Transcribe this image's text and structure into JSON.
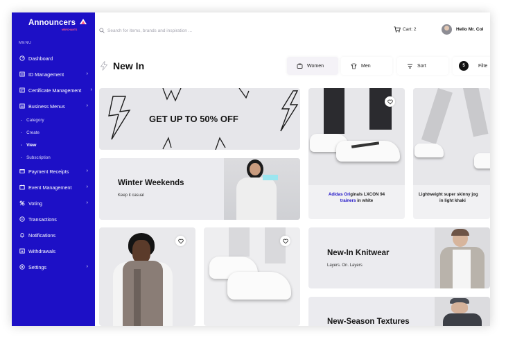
{
  "app": {
    "brand": "Announcers",
    "brand_sub": "MERCHANTS",
    "menu_heading": "MENU"
  },
  "sidebar": {
    "items": [
      {
        "label": "Dashboard",
        "icon": "dashboard-icon",
        "has_children": false
      },
      {
        "label": "ID Management",
        "icon": "id-card-icon",
        "has_children": true
      },
      {
        "label": "Certificate Management",
        "icon": "certificate-icon",
        "has_children": true
      },
      {
        "label": "Business Menus",
        "icon": "business-icon",
        "has_children": true
      },
      {
        "label": "Payment Receipts",
        "icon": "receipt-icon",
        "has_children": true
      },
      {
        "label": "Event Management",
        "icon": "event-icon",
        "has_children": true
      },
      {
        "label": "Voting",
        "icon": "voting-icon",
        "has_children": true
      },
      {
        "label": "Transactions",
        "icon": "transactions-icon",
        "has_children": false
      },
      {
        "label": "Notifications",
        "icon": "bell-icon",
        "has_children": false
      },
      {
        "label": "Withdrawals",
        "icon": "withdrawal-icon",
        "has_children": false
      },
      {
        "label": "Settings",
        "icon": "settings-icon",
        "has_children": true
      }
    ],
    "sub_items": [
      {
        "label": "Category",
        "active": false
      },
      {
        "label": "Create",
        "active": false
      },
      {
        "label": "View",
        "active": true
      },
      {
        "label": "Subscription",
        "active": false
      }
    ]
  },
  "topbar": {
    "search_placeholder": "Search for items, brands and inspiration ...",
    "cart_label": "Cart: 2",
    "user_greeting": "Hello Mr. Col"
  },
  "page": {
    "title": "New In",
    "filters": [
      {
        "label": "Women",
        "icon": "women-icon",
        "active": true
      },
      {
        "label": "Men",
        "icon": "men-icon",
        "active": false
      },
      {
        "label": "Sort",
        "icon": "sort-icon",
        "active": false
      }
    ],
    "filter_label": "Filte",
    "filter_count": "5"
  },
  "promos": {
    "sale_title": "GET UP TO 50% OFF",
    "winter_title": "Winter Weekends",
    "winter_sub": "Keep it casual",
    "knitwear_title": "New-In Knitwear",
    "knitwear_sub": "Layers. On. Layers",
    "textures_title": "New-Season Textures"
  },
  "products": [
    {
      "name_highlight": "Adidas Ori",
      "name_rest": "ginals LXCON 94",
      "name_line2_highlight": "trainers",
      "name_line2_rest": " in white"
    },
    {
      "name_line1": "Lightweight super skinny jog",
      "name_line2": "in light khaki"
    }
  ],
  "colors": {
    "sidebar": "#1d10c6",
    "card": "#ebebef",
    "accent": "#1d10c6"
  }
}
